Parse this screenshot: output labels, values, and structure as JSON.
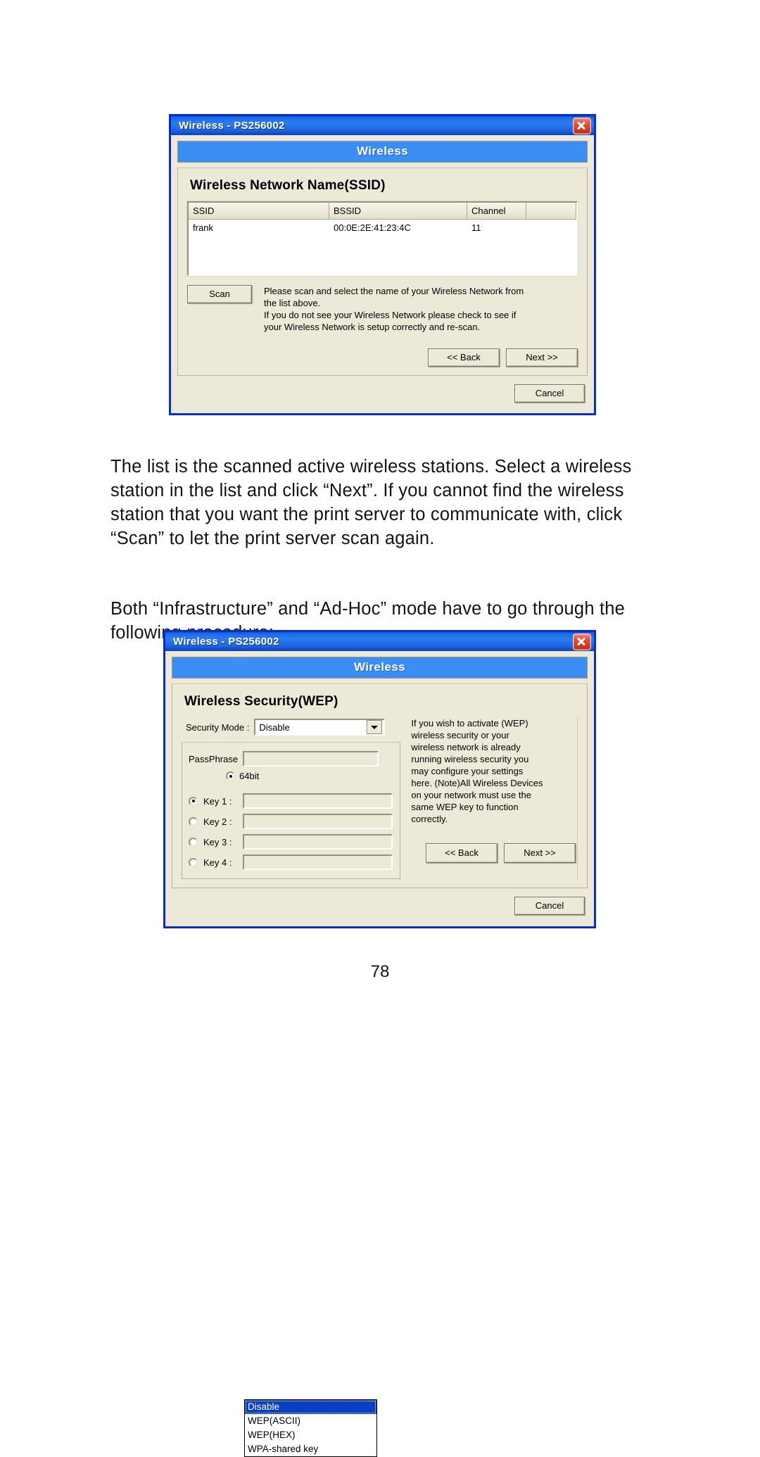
{
  "page": {
    "number": "78",
    "paragraphs": [
      "The list is the scanned active wireless stations. Select a wireless station in the list and click “Next”. If you cannot find the wireless station that you want the print server to communicate with, click “Scan” to let the print server scan again.",
      "Both “Infrastructure” and “Ad-Hoc” mode have to go through the following procedure:"
    ]
  },
  "colors": {
    "title_bar_blue": "#1d6ae8",
    "dialog_border": "#0a2ec1",
    "banner_blue": "#3a8ef5",
    "dialog_face": "#ece9d8",
    "selection_blue": "#0a3fc4",
    "close_red": "#c62a14"
  },
  "dialog1": {
    "title": "Wireless - PS256002",
    "close_icon": "close-icon",
    "banner": "Wireless",
    "panel_title": "Wireless Network Name(SSID)",
    "table": {
      "columns": [
        "SSID",
        "BSSID",
        "Channel",
        ""
      ],
      "rows": [
        [
          "frank",
          "00:0E:2E:41:23:4C",
          "11",
          ""
        ]
      ]
    },
    "scan_label": "Scan",
    "help_lines": [
      "Please scan and select the name of your Wireless Network from",
      "the list above.",
      "If you do not see your Wireless Network please check to see if",
      "your Wireless Network is setup correctly and re-scan."
    ],
    "back_label": "<< Back",
    "next_label": "Next >>",
    "cancel_label": "Cancel"
  },
  "dialog2": {
    "title": "Wireless - PS256002",
    "close_icon": "close-icon",
    "banner": "Wireless",
    "panel_title": "Wireless Security(WEP)",
    "security_mode": {
      "label": "Security Mode :",
      "value": "Disable",
      "expanded": true,
      "options": [
        "Disable",
        "WEP(ASCII)",
        "WEP(HEX)",
        "WPA-shared key"
      ],
      "selected_index": 0
    },
    "passphrase": {
      "label": "PassPhrase",
      "value": ""
    },
    "bits_option": {
      "label": "64bit",
      "selected": true
    },
    "keys": [
      {
        "label": "Key 1 :",
        "value": "",
        "selected": true
      },
      {
        "label": "Key 2 :",
        "value": "",
        "selected": false
      },
      {
        "label": "Key 3 :",
        "value": "",
        "selected": false
      },
      {
        "label": "Key 4 :",
        "value": "",
        "selected": false
      }
    ],
    "help_lines": [
      "If you wish to activate (WEP)",
      "wireless security or your",
      "wireless network is already",
      "running wireless security you",
      "may configure your settings",
      "here. (Note)All Wireless Devices",
      "on your network must use the",
      "same WEP key to function",
      "correctly."
    ],
    "back_label": "<< Back",
    "next_label": "Next >>",
    "cancel_label": "Cancel"
  }
}
